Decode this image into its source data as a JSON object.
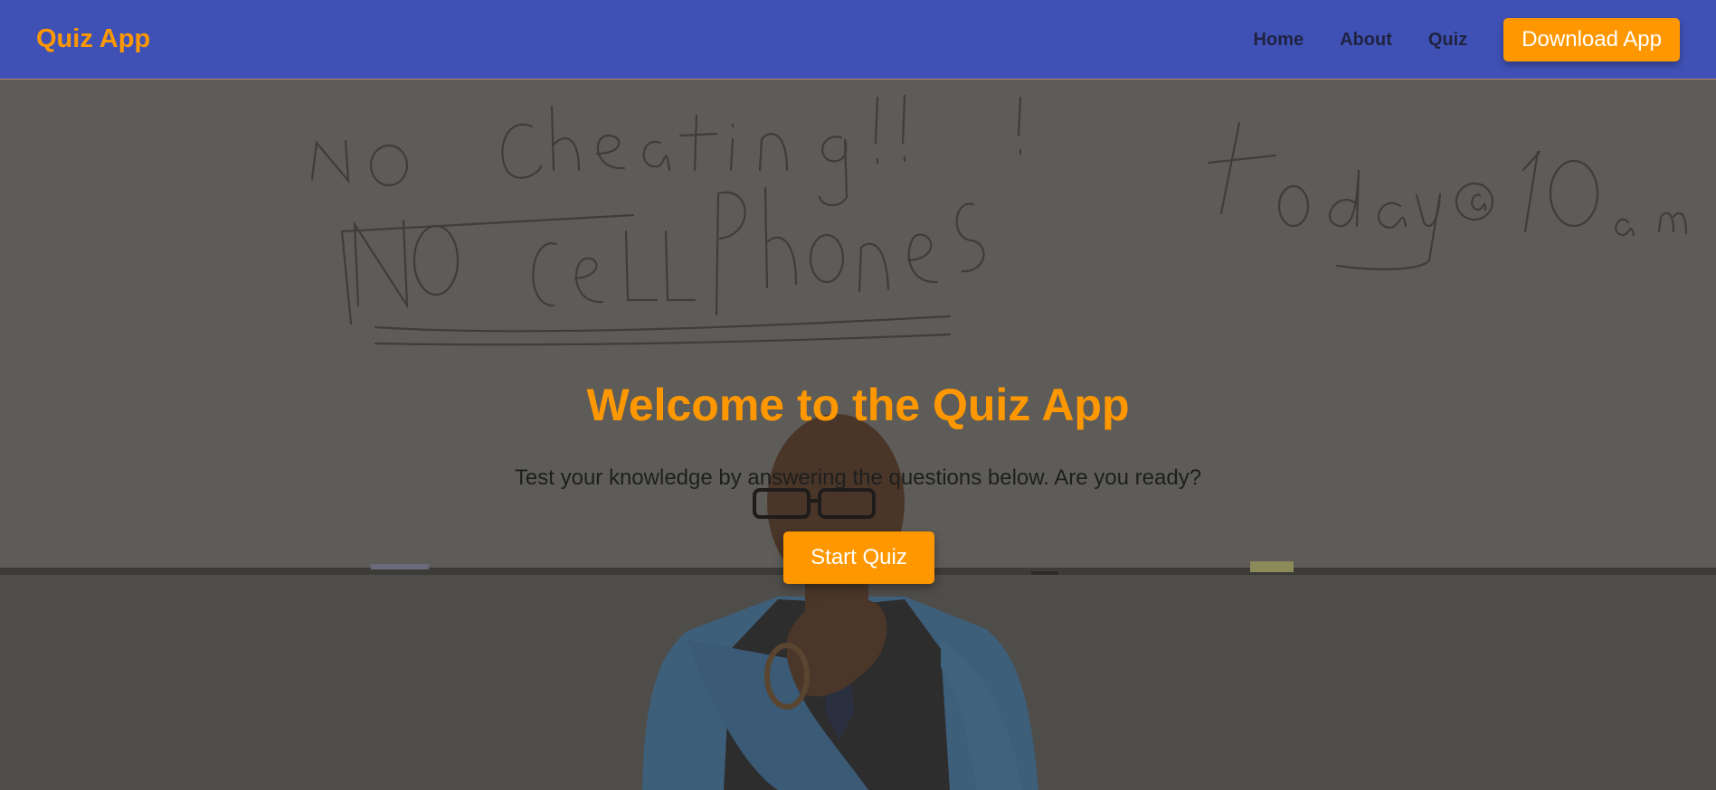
{
  "navbar": {
    "brand": "Quiz App",
    "links": [
      "Home",
      "About",
      "Quiz"
    ],
    "download_label": "Download App"
  },
  "hero": {
    "title": "Welcome to the Quiz App",
    "subtitle": "Test your knowledge by answering the questions below. Are you ready?",
    "start_label": "Start Quiz",
    "background_image": "classroom-whiteboard-photo",
    "whiteboard_text": [
      "NO Cheating!!!",
      "NO CeLLphones",
      "Today @ 10a.m."
    ]
  },
  "colors": {
    "nav_bg": "#3f51b5",
    "accent": "#ff9800",
    "nav_text": "#1f2340",
    "overlay": "#4a4844"
  }
}
